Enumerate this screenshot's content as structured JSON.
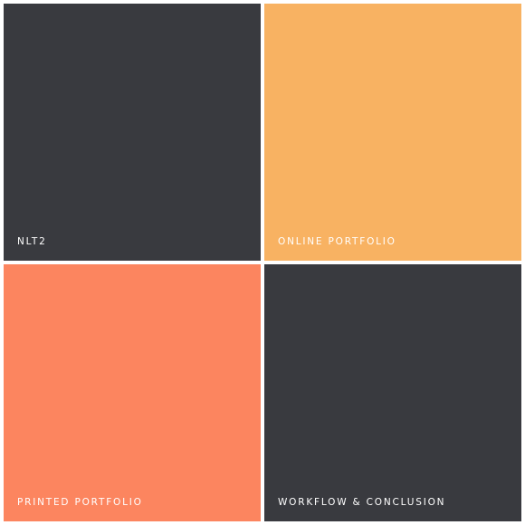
{
  "tiles": [
    {
      "label": "NLT2",
      "color": "#393a3f"
    },
    {
      "label": "ONLINE PORTFOLIO",
      "color": "#f8b262"
    },
    {
      "label": "PRINTED PORTFOLIO",
      "color": "#fc855f"
    },
    {
      "label": "WORKFLOW & CONCLUSION",
      "color": "#393a3f"
    }
  ]
}
